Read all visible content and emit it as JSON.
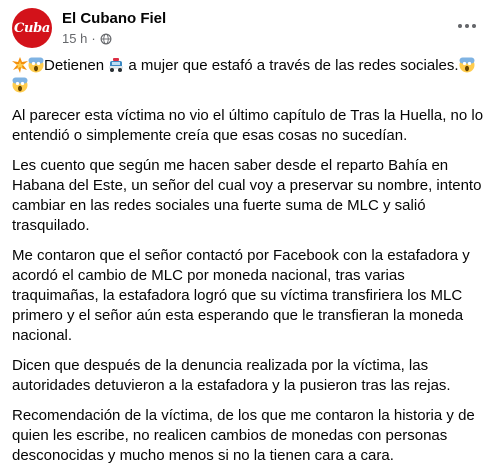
{
  "post": {
    "author": "El Cubano Fiel",
    "avatar_text": "Cuba",
    "time": "15 h",
    "separator": "·",
    "audience_icon": "globe-icon",
    "more_icon": "more-horizontal-icon",
    "headline_emoji_1": "collision-emoji",
    "headline_emoji_2": "screaming-face-emoji",
    "headline_text_1": "Detienen",
    "headline_emoji_3": "police-car-emoji",
    "headline_text_2": " a mujer que estafó a través de las redes sociales.",
    "headline_emoji_4": "screaming-face-emoji",
    "headline_emoji_5": "screaming-face-emoji",
    "paragraphs": [
      "Al parecer esta víctima no vio el último capítulo de Tras la Huella, no lo entendió o simplemente creía que esas cosas no sucedían.",
      "Les cuento que según me hacen saber desde el reparto Bahía en Habana del Este, un señor del cual voy a preservar su nombre, intento cambiar en las redes sociales una fuerte suma de MLC y salió trasquilado.",
      "Me contaron que el señor contactó por Facebook con la estafadora y acordó el cambio de MLC por moneda nacional, tras varias traquimañas, la estafadora logró que su víctima transfiriera los MLC primero y el señor aún esta esperando que le transfieran la moneda nacional.",
      "Dicen que después de la denuncia realizada por la víctima, las autoridades detuvieron a la estafadora y la pusieron tras las rejas.",
      "Recomendación de la víctima, de los que me contaron la historia y de quien les escribe, no realicen cambios de monedas con personas desconocidas y mucho menos si no la tienen cara a cara."
    ]
  },
  "colors": {
    "brand_red": "#d3121a",
    "text": "#050505",
    "secondary_text": "#65676b"
  }
}
